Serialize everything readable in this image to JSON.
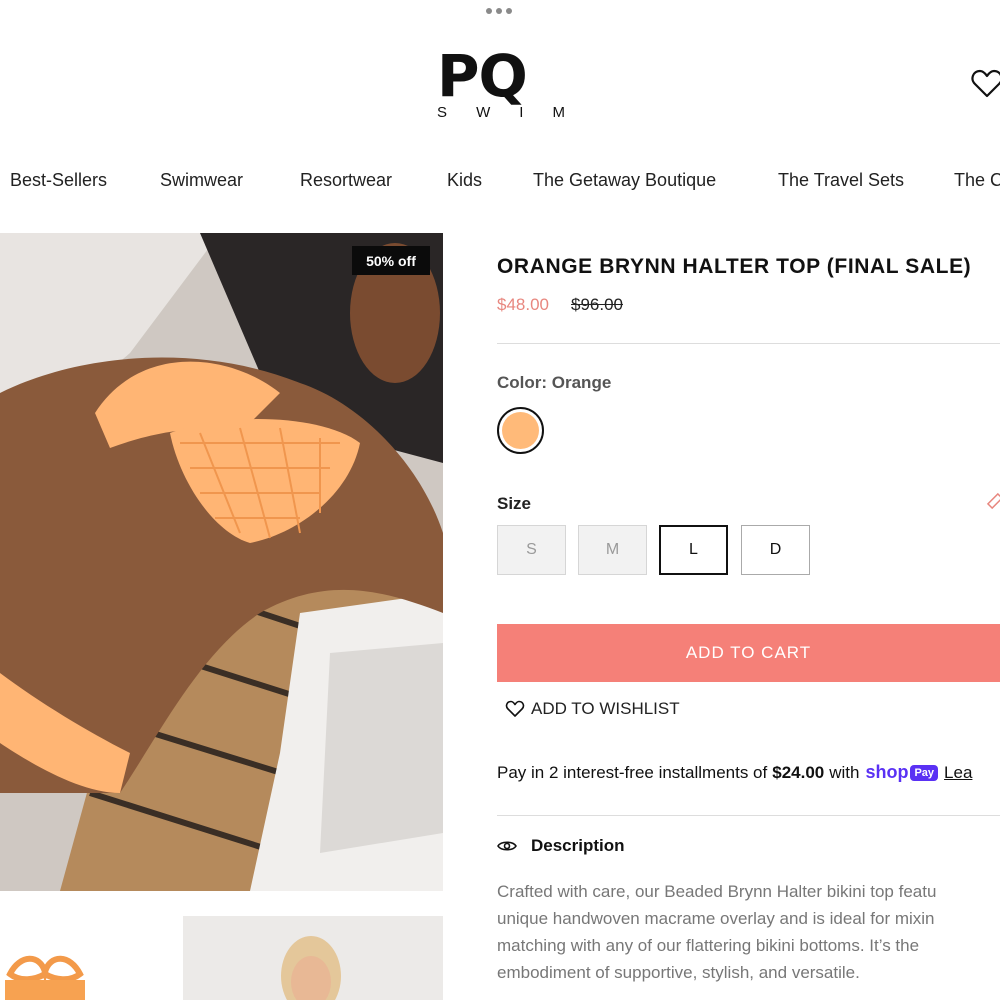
{
  "brand": {
    "logo_main": "PQ",
    "logo_sub": [
      "S",
      "W",
      "I",
      "M"
    ]
  },
  "header": {
    "wishlist_icon": "heart-icon"
  },
  "nav": {
    "items": [
      "Best-Sellers",
      "Swimwear",
      "Resortwear",
      "Kids",
      "The Getaway Boutique",
      "The Travel Sets",
      "The C"
    ]
  },
  "gallery": {
    "badge": "50% off"
  },
  "product": {
    "title": "ORANGE BRYNN HALTER TOP (FINAL SALE)",
    "sale_price": "$48.00",
    "original_price": "$96.00",
    "color_label": "Color: Orange",
    "swatch_color": "#ffba79",
    "size_label": "Size",
    "sizes": [
      {
        "label": "S",
        "state": "unavailable"
      },
      {
        "label": "M",
        "state": "unavailable"
      },
      {
        "label": "L",
        "state": "selected"
      },
      {
        "label": "D",
        "state": "available"
      }
    ],
    "add_to_cart": "ADD TO CART",
    "add_to_wishlist": "ADD TO WISHLIST"
  },
  "installments": {
    "prefix": "Pay in 2 interest-free installments of",
    "amount": "$24.00",
    "middle": "with",
    "shop_word": "shop",
    "pay_word": "Pay",
    "learn": "Lea"
  },
  "description": {
    "heading": "Description",
    "lines": [
      "Crafted with care, our Beaded Brynn Halter bikini top featu",
      "unique handwoven macrame overlay and is ideal for mixin",
      "matching with any of our flattering bikini bottoms. It’s the",
      "embodiment of supportive, stylish, and versatile."
    ]
  },
  "colors": {
    "accent": "#f58078",
    "sale_price": "#e8877f",
    "shop_pay": "#5a31f4"
  }
}
